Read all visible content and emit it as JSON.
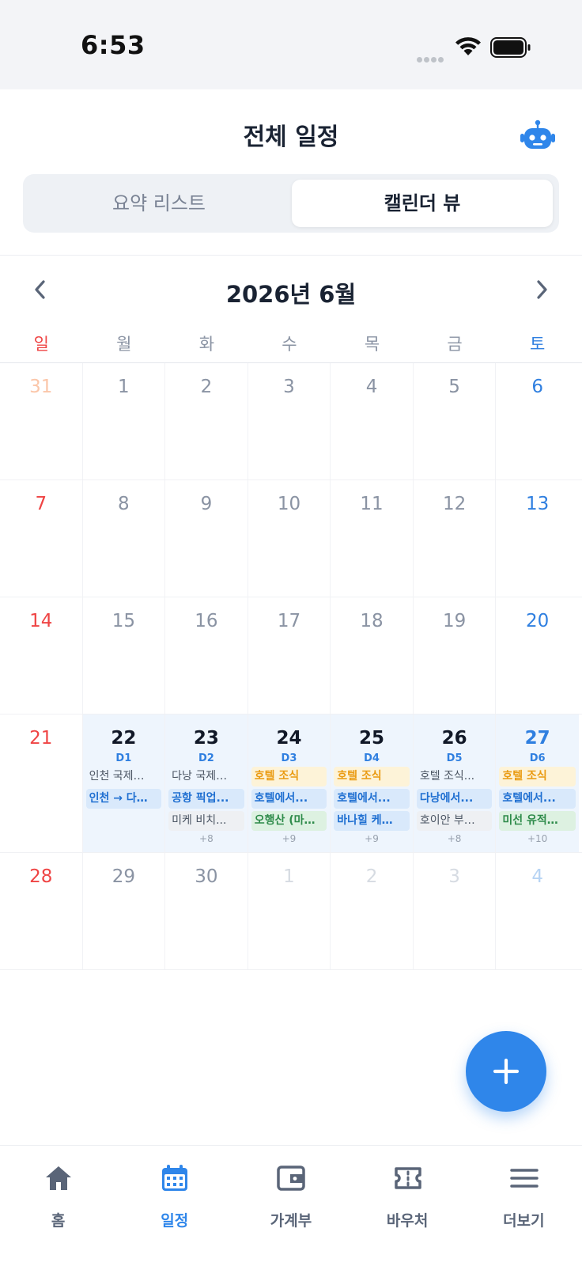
{
  "status_bar": {
    "time": "6:53"
  },
  "header": {
    "title": "전체 일정",
    "segments": {
      "list": "요약 리스트",
      "calendar": "캘린더 뷰"
    },
    "active_segment": "calendar"
  },
  "calendar": {
    "month_label": "2026년 6월",
    "weekdays": [
      "일",
      "월",
      "화",
      "수",
      "목",
      "금",
      "토"
    ],
    "weeks": [
      {
        "days": [
          {
            "n": "31",
            "state": "dim"
          },
          {
            "n": "1"
          },
          {
            "n": "2"
          },
          {
            "n": "3"
          },
          {
            "n": "4"
          },
          {
            "n": "5"
          },
          {
            "n": "6"
          }
        ]
      },
      {
        "days": [
          {
            "n": "7"
          },
          {
            "n": "8"
          },
          {
            "n": "9"
          },
          {
            "n": "10"
          },
          {
            "n": "11"
          },
          {
            "n": "12"
          },
          {
            "n": "13"
          }
        ]
      },
      {
        "days": [
          {
            "n": "14"
          },
          {
            "n": "15"
          },
          {
            "n": "16"
          },
          {
            "n": "17"
          },
          {
            "n": "18"
          },
          {
            "n": "19"
          },
          {
            "n": "20"
          }
        ]
      },
      {
        "trip": true,
        "days": [
          {
            "n": "21"
          },
          {
            "n": "22",
            "trip_day": "D1",
            "events": [
              {
                "text": "인천 국제…",
                "style": "plain"
              },
              {
                "text": "인천 → 다…",
                "style": "blue"
              }
            ]
          },
          {
            "n": "23",
            "trip_day": "D2",
            "events": [
              {
                "text": "다낭 국제…",
                "style": "plain"
              },
              {
                "text": "공항 픽업...",
                "style": "blue"
              },
              {
                "text": "미케 비치...",
                "style": "gray"
              }
            ],
            "more": "+8"
          },
          {
            "n": "24",
            "trip_day": "D3",
            "events": [
              {
                "text": "호텔 조식",
                "style": "orange"
              },
              {
                "text": "호텔에서...",
                "style": "blue"
              },
              {
                "text": "오행산 (마…",
                "style": "green"
              }
            ],
            "more": "+9"
          },
          {
            "n": "25",
            "trip_day": "D4",
            "events": [
              {
                "text": "호텔 조식",
                "style": "orange"
              },
              {
                "text": "호텔에서...",
                "style": "blue"
              },
              {
                "text": "바나힐 케…",
                "style": "blue"
              }
            ],
            "more": "+9"
          },
          {
            "n": "26",
            "trip_day": "D5",
            "events": [
              {
                "text": "호텔 조식...",
                "style": "plain"
              },
              {
                "text": "다낭에서...",
                "style": "blue"
              },
              {
                "text": "호이안 부…",
                "style": "gray"
              }
            ],
            "more": "+8"
          },
          {
            "n": "27",
            "trip_day": "D6",
            "events": [
              {
                "text": "호텔 조식",
                "style": "orange"
              },
              {
                "text": "호텔에서...",
                "style": "blue"
              },
              {
                "text": "미선 유적…",
                "style": "green"
              }
            ],
            "more": "+10"
          }
        ]
      },
      {
        "days": [
          {
            "n": "28"
          },
          {
            "n": "29"
          },
          {
            "n": "30"
          },
          {
            "n": "1",
            "state": "dim"
          },
          {
            "n": "2",
            "state": "dim"
          },
          {
            "n": "3",
            "state": "dim"
          },
          {
            "n": "4",
            "state": "dim"
          }
        ]
      }
    ]
  },
  "tabbar": {
    "items": [
      {
        "label": "홈",
        "icon": "home-icon"
      },
      {
        "label": "일정",
        "icon": "calendar-icon",
        "active": true
      },
      {
        "label": "가계부",
        "icon": "wallet-icon"
      },
      {
        "label": "바우처",
        "icon": "ticket-icon"
      },
      {
        "label": "더보기",
        "icon": "menu-icon"
      }
    ]
  },
  "colors": {
    "accent": "#2f86ea",
    "sunday": "#ef4444",
    "saturday": "#2f7fe0"
  }
}
